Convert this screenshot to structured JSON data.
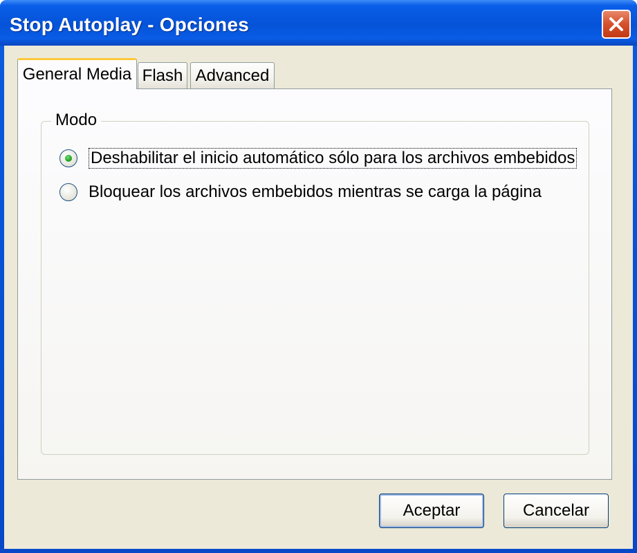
{
  "window": {
    "title": "Stop Autoplay - Opciones"
  },
  "tabs": [
    {
      "label": "General Media",
      "active": true
    },
    {
      "label": "Flash",
      "active": false
    },
    {
      "label": "Advanced",
      "active": false
    }
  ],
  "group": {
    "label": "Modo",
    "options": [
      {
        "label": "Deshabilitar el inicio automático sólo para los archivos embebidos",
        "selected": true
      },
      {
        "label": "Bloquear los archivos embebidos mientras se carga la página",
        "selected": false
      }
    ]
  },
  "buttons": {
    "ok": "Aceptar",
    "cancel": "Cancelar"
  },
  "colors": {
    "titlebar": "#0553d8",
    "close": "#d5502c",
    "radio_checked": "#21a121",
    "tab_highlight": "#ffc83c"
  },
  "icons": {
    "close": "close-icon"
  }
}
